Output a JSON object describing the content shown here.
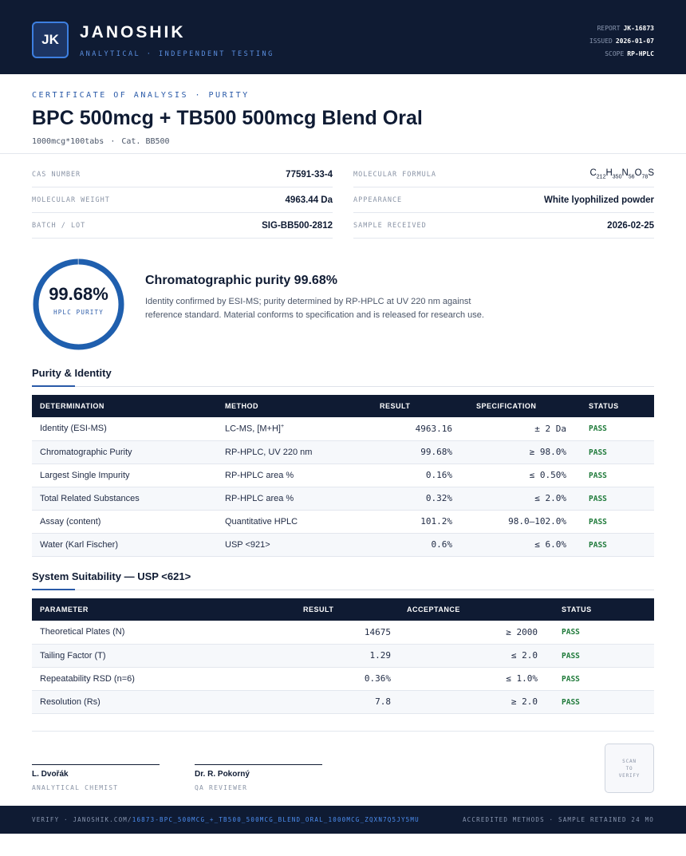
{
  "header": {
    "logo_initials": "JK",
    "brand_name": "JANOSHIK",
    "brand_tagline": "ANALYTICAL · INDEPENDENT TESTING",
    "report_label": "REPORT",
    "report_value": "JK-16873",
    "issued_label": "ISSUED",
    "issued_value": "2026-01-07",
    "scope_label": "SCOPE",
    "scope_value": "RP-HPLC"
  },
  "title_block": {
    "eyebrow": "CERTIFICATE OF ANALYSIS · PURITY",
    "title": "BPC 500mcg + TB500 500mcg Blend Oral",
    "format": "1000mcg*100tabs",
    "catalog": "Cat. BB500"
  },
  "meta": {
    "cas_label": "CAS NUMBER",
    "cas_value": "77591-33-4",
    "formula_label": "MOLECULAR FORMULA",
    "formula": {
      "c": "C",
      "c_n": "212",
      "h": "H",
      "h_n": "350",
      "n": "N",
      "n_n": "56",
      "o": "O",
      "o_n": "78",
      "s": "S"
    },
    "mw_label": "MOLECULAR WEIGHT",
    "mw_value": "4963.44 Da",
    "appearance_label": "APPEARANCE",
    "appearance_value": "White lyophilized powder",
    "batch_label": "BATCH / LOT",
    "batch_value": "SIG-BB500-2812",
    "received_label": "SAMPLE RECEIVED",
    "received_value": "2026-02-25"
  },
  "purity": {
    "value_text": "99.68%",
    "fraction": 0.9968,
    "ring_label": "HPLC PURITY",
    "summary_title": "Chromatographic purity 99.68%",
    "summary_text": "Identity confirmed by ESI-MS; purity determined by RP-HPLC at UV 220 nm against reference standard. Material conforms to specification and is released for research use."
  },
  "purity_identity": {
    "title": "Purity & Identity",
    "headers": [
      "DETERMINATION",
      "METHOD",
      "RESULT",
      "SPECIFICATION",
      "STATUS"
    ],
    "rows": [
      {
        "determination": "Identity (ESI-MS)",
        "method": "LC-MS, [M+H]",
        "method_sup": "+",
        "result": "4963.16",
        "spec": "± 2 Da",
        "status": "PASS"
      },
      {
        "determination": "Chromatographic Purity",
        "method": "RP-HPLC, UV 220 nm",
        "method_sup": "",
        "result": "99.68%",
        "spec": "≥ 98.0%",
        "status": "PASS"
      },
      {
        "determination": "Largest Single Impurity",
        "method": "RP-HPLC area %",
        "method_sup": "",
        "result": "0.16%",
        "spec": "≤ 0.50%",
        "status": "PASS"
      },
      {
        "determination": "Total Related Substances",
        "method": "RP-HPLC area %",
        "method_sup": "",
        "result": "0.32%",
        "spec": "≤ 2.0%",
        "status": "PASS"
      },
      {
        "determination": "Assay (content)",
        "method": "Quantitative HPLC",
        "method_sup": "",
        "result": "101.2%",
        "spec": "98.0–102.0%",
        "status": "PASS"
      },
      {
        "determination": "Water (Karl Fischer)",
        "method": "USP <921>",
        "method_sup": "",
        "result": "0.6%",
        "spec": "≤ 6.0%",
        "status": "PASS"
      }
    ]
  },
  "system_suitability": {
    "title": "System Suitability — USP <621>",
    "headers": [
      "PARAMETER",
      "RESULT",
      "ACCEPTANCE",
      "STATUS"
    ],
    "rows": [
      {
        "parameter": "Theoretical Plates (N)",
        "result": "14675",
        "acceptance": "≥ 2000",
        "status": "PASS"
      },
      {
        "parameter": "Tailing Factor (T)",
        "result": "1.29",
        "acceptance": "≤ 2.0",
        "status": "PASS"
      },
      {
        "parameter": "Repeatability RSD (n=6)",
        "result": "0.36%",
        "acceptance": "≤ 1.0%",
        "status": "PASS"
      },
      {
        "parameter": "Resolution (Rs)",
        "result": "7.8",
        "acceptance": "≥ 2.0",
        "status": "PASS"
      }
    ]
  },
  "signatures": [
    {
      "name": "L. Dvořák",
      "role": "ANALYTICAL CHEMIST"
    },
    {
      "name": "Dr. R. Pokorný",
      "role": "QA REVIEWER"
    }
  ],
  "qr": {
    "line1": "SCAN",
    "line2": "TO",
    "line3": "VERIFY"
  },
  "footer": {
    "verify_prefix": "VERIFY · JANOSHIK.COM/",
    "verify_link": "16873-BPC_500MCG_+_TB500_500MCG_BLEND_ORAL_1000MCG_ZQXN7Q5JY5MU",
    "right_text": "ACCREDITED METHODS · SAMPLE RETAINED 24 MO"
  },
  "colors": {
    "navy": "#0f1b33",
    "accent": "#2a5aa8",
    "ring": "#1f5fae",
    "pass": "#1f7a3a"
  }
}
